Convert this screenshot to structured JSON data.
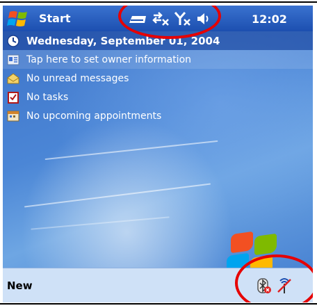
{
  "title_bar": {
    "start_label": "Start",
    "clock": "12:02",
    "status_icons": [
      "connectivity-icon",
      "sync-disconnected-icon",
      "signal-off-icon",
      "speaker-muted-icon"
    ]
  },
  "today": {
    "date": "Wednesday, September 01, 2004",
    "items": [
      {
        "icon": "owner-card-icon",
        "label": "Tap here to set owner information"
      },
      {
        "icon": "messages-icon",
        "label": "No unread messages"
      },
      {
        "icon": "tasks-icon",
        "label": "No tasks"
      },
      {
        "icon": "calendar-icon",
        "label": "No upcoming appointments"
      }
    ]
  },
  "menubar": {
    "new_label": "New",
    "system_tray": [
      "bluetooth-icon",
      "wireless-off-icon"
    ]
  },
  "colors": {
    "title_bar": "#1c4fb0",
    "menubar": "#cfe1f7",
    "annotation_circle": "#e60000"
  }
}
